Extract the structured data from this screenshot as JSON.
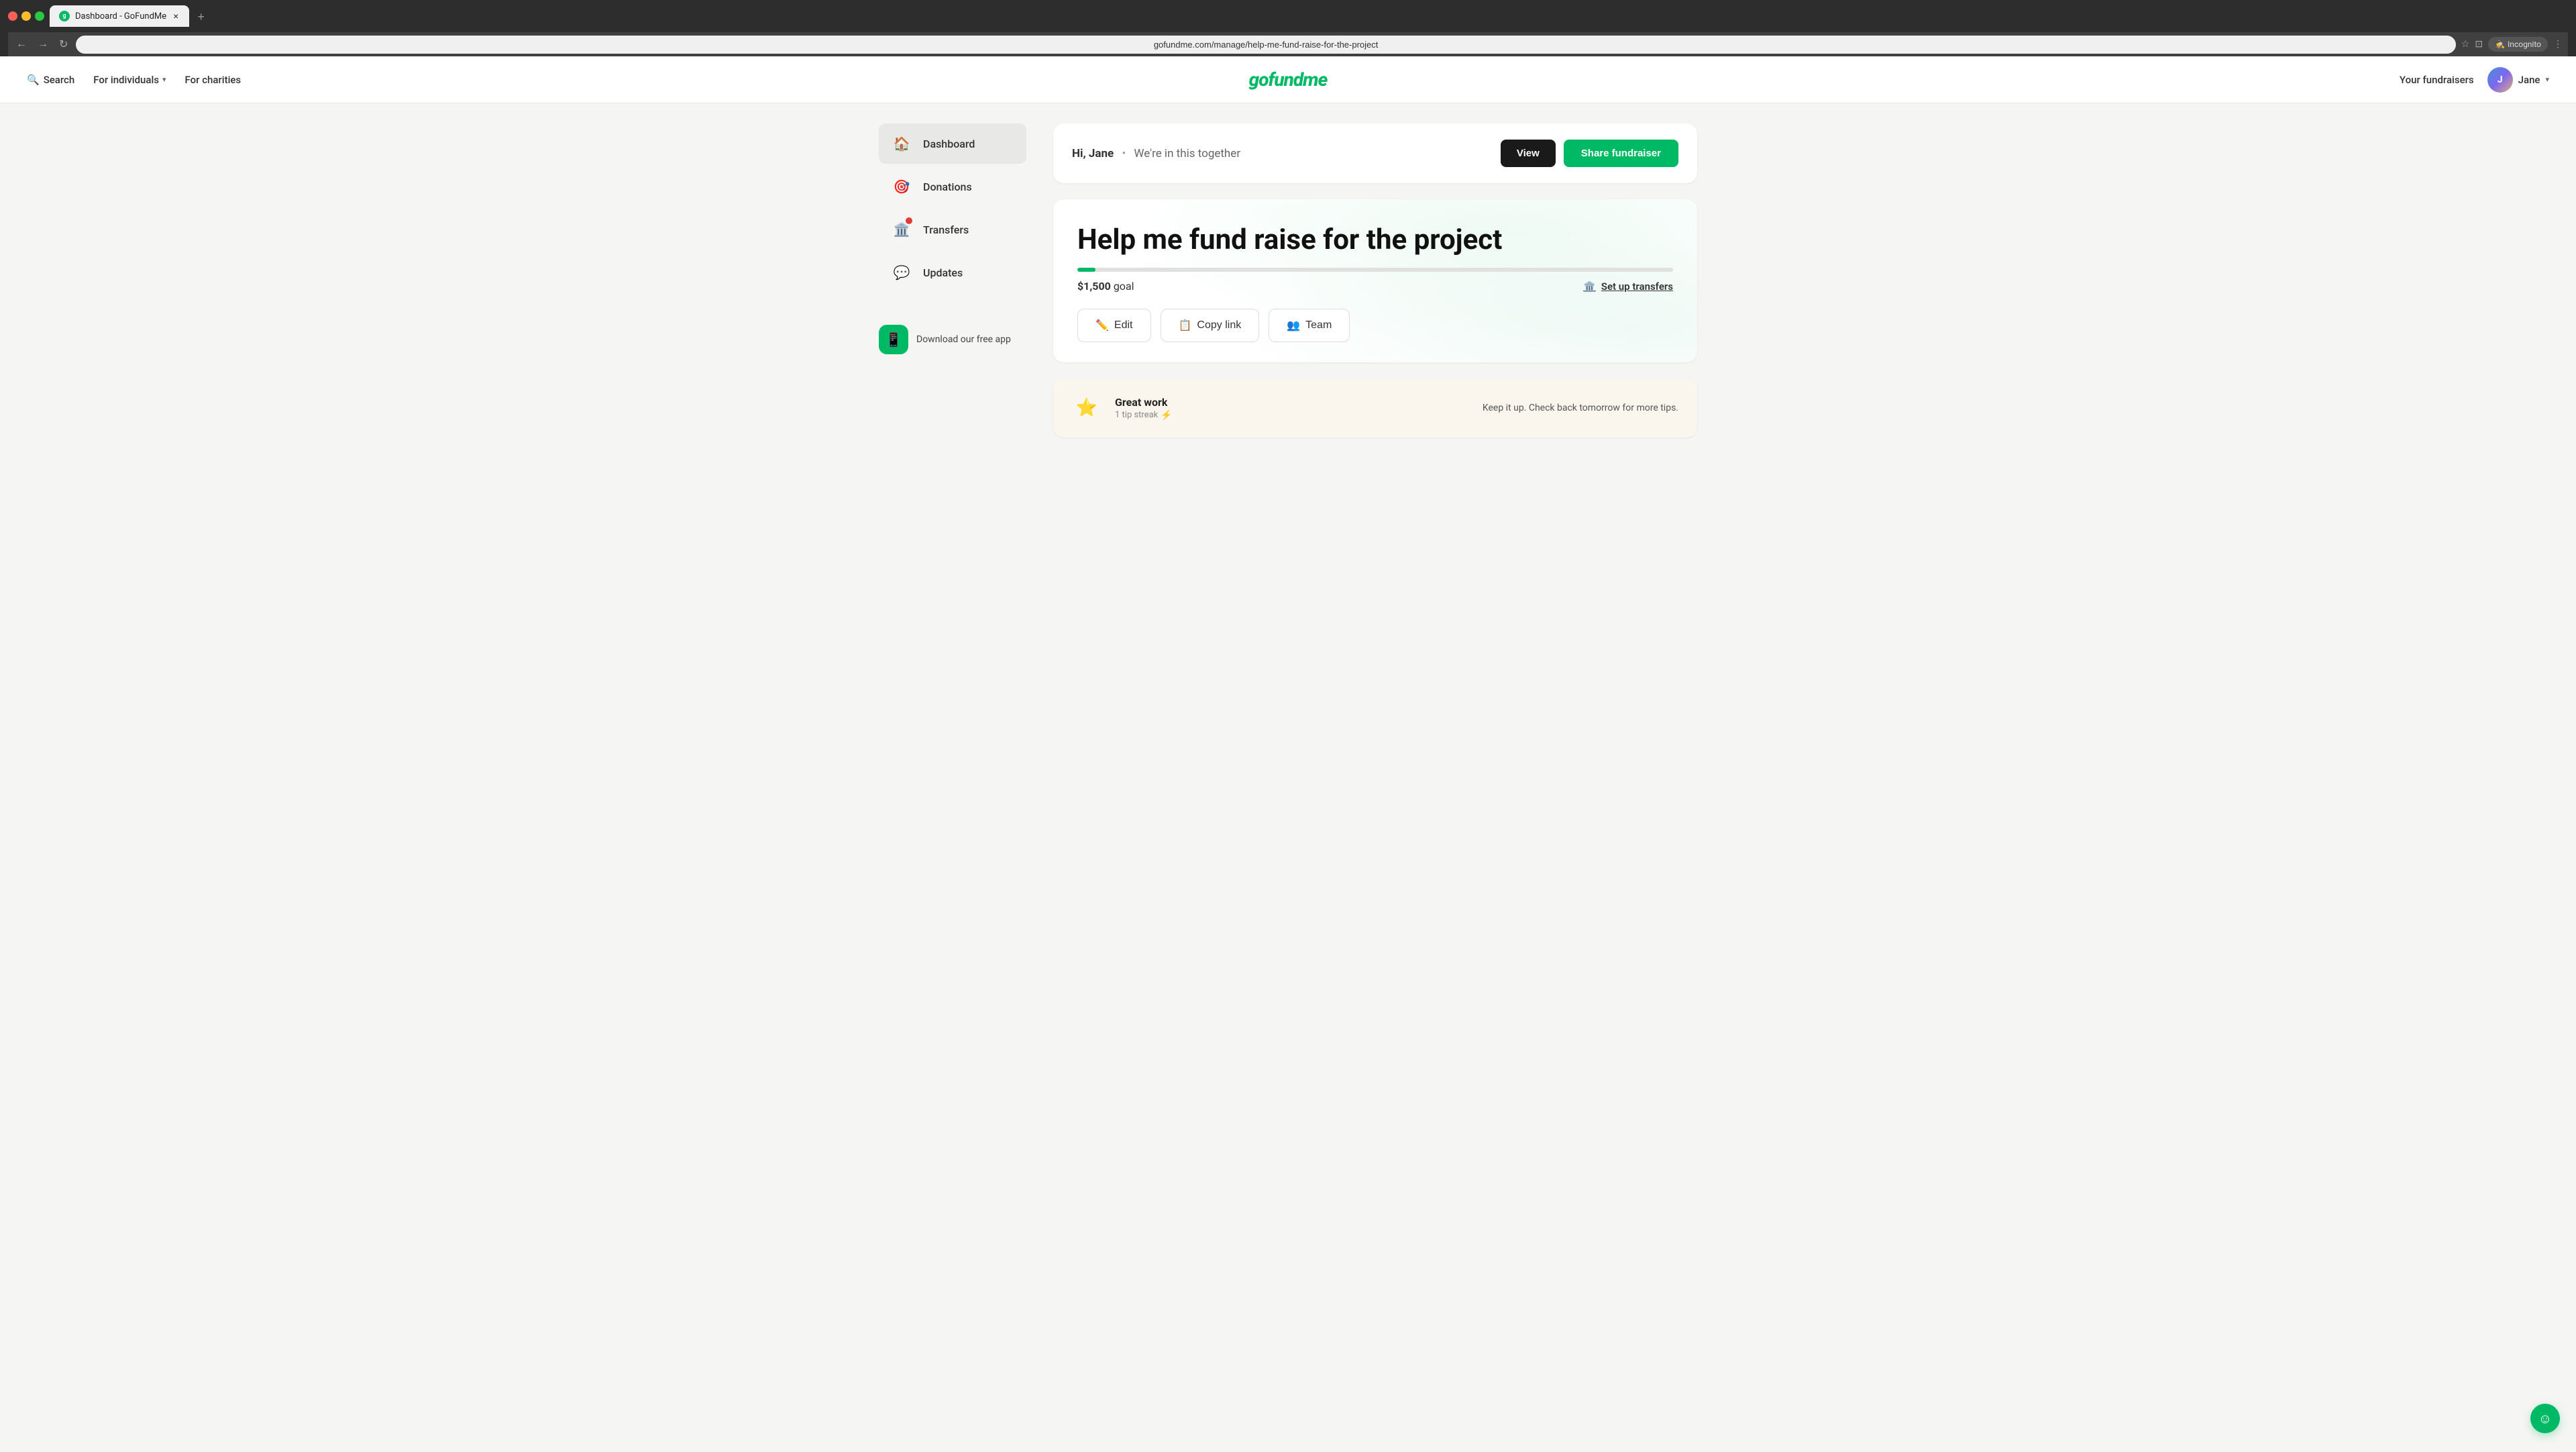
{
  "browser": {
    "tab_title": "Dashboard - GoFundMe",
    "url": "gofundme.com/manage/help-me-fund-raise-for-the-project",
    "nav_back_label": "←",
    "nav_forward_label": "→",
    "nav_refresh_label": "↻",
    "incognito_label": "Incognito",
    "new_tab_label": "+",
    "tab_close_label": "×"
  },
  "header": {
    "search_label": "Search",
    "for_individuals_label": "For individuals",
    "for_charities_label": "For charities",
    "logo_text": "gofundme",
    "your_fundraisers_label": "Your fundraisers",
    "user_name": "Jane"
  },
  "sidebar": {
    "items": [
      {
        "id": "dashboard",
        "label": "Dashboard",
        "icon": "🏠",
        "active": true,
        "has_notification": false
      },
      {
        "id": "donations",
        "label": "Donations",
        "icon": "🎯",
        "active": false,
        "has_notification": false
      },
      {
        "id": "transfers",
        "label": "Transfers",
        "icon": "🏛️",
        "active": false,
        "has_notification": true
      },
      {
        "id": "updates",
        "label": "Updates",
        "icon": "💬",
        "active": false,
        "has_notification": false
      }
    ],
    "download_app_label": "Download our free app"
  },
  "dashboard": {
    "greeting": "Hi, Jane",
    "separator": "•",
    "subtitle": "We're in this together",
    "view_button_label": "View",
    "share_button_label": "Share fundraiser"
  },
  "fundraiser": {
    "title": "Help me fund raise for the project",
    "goal_amount": "$1,500",
    "goal_label": "goal",
    "progress_percent": 3,
    "setup_transfers_icon": "🏛️",
    "setup_transfers_label": "Set up transfers",
    "edit_label": "Edit",
    "copy_link_label": "Copy link",
    "team_label": "Team"
  },
  "tips": {
    "title": "Great work",
    "streak_label": "1 tip streak",
    "streak_icon": "⚡",
    "body": "Keep it up. Check back tomorrow for more tips."
  },
  "chat": {
    "icon": "☺"
  }
}
